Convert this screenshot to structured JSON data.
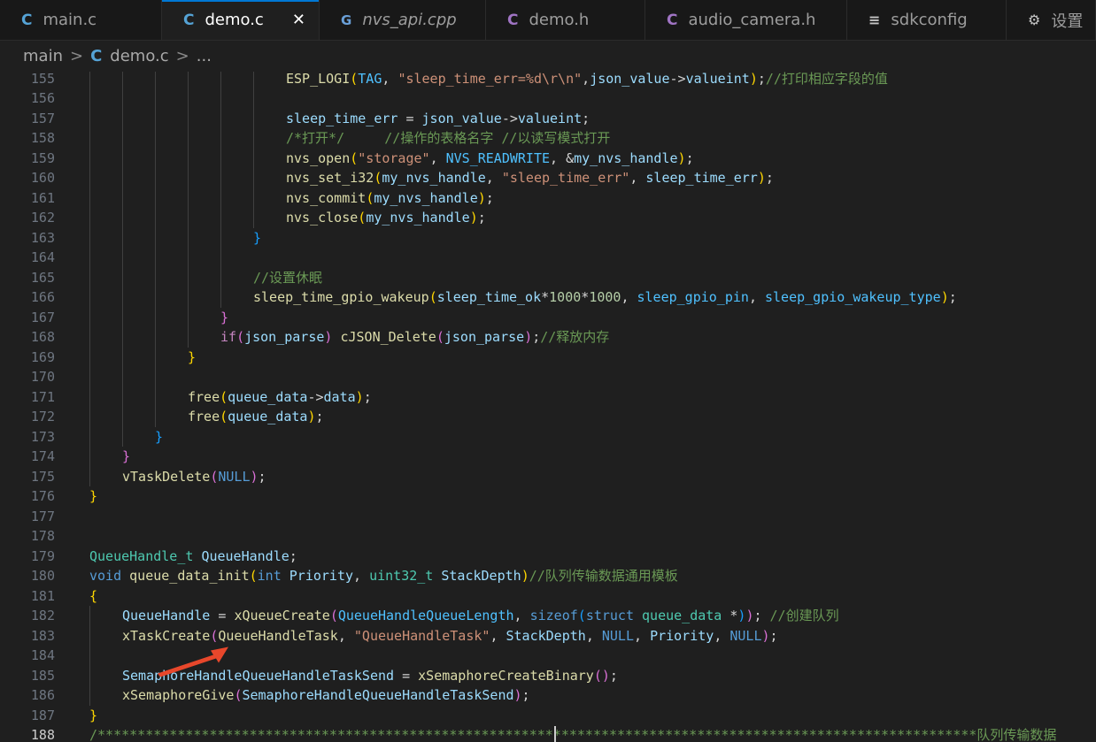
{
  "tabs": [
    {
      "icon": "C",
      "icon_kind": "c",
      "label": "main.c",
      "active": false,
      "italic": false
    },
    {
      "icon": "C",
      "icon_kind": "c",
      "label": "demo.c",
      "active": true,
      "italic": false,
      "close": "✕"
    },
    {
      "icon": "G",
      "icon_kind": "cpp",
      "label": "nvs_api.cpp",
      "active": false,
      "italic": true
    },
    {
      "icon": "C",
      "icon_kind": "h",
      "label": "demo.h",
      "active": false,
      "italic": false
    },
    {
      "icon": "C",
      "icon_kind": "h",
      "label": "audio_camera.h",
      "active": false,
      "italic": false
    },
    {
      "icon": "≡",
      "icon_kind": "menu",
      "label": "sdkconfig",
      "active": false,
      "italic": false
    },
    {
      "icon": "⚙",
      "icon_kind": "menu",
      "label": "设置",
      "active": false,
      "italic": false
    }
  ],
  "breadcrumb": {
    "folder": "main",
    "sep": ">",
    "icon": "C",
    "file": "demo.c",
    "ellipsis": "..."
  },
  "current_line": 188,
  "lines": [
    {
      "n": "155",
      "indent": 6,
      "t": [
        [
          "fn",
          "ESP_LOGI"
        ],
        [
          "b1",
          "("
        ],
        [
          "macro",
          "TAG"
        ],
        [
          "plain",
          ", "
        ],
        [
          "str",
          "\"sleep_time_err=%d\\r\\n\""
        ],
        [
          "plain",
          ","
        ],
        [
          "var",
          "json_value"
        ],
        [
          "plain",
          "->"
        ],
        [
          "var",
          "valueint"
        ],
        [
          "b1",
          ")"
        ],
        [
          "plain",
          ";"
        ],
        [
          "cmt",
          "//打印相应字段的值"
        ]
      ]
    },
    {
      "n": "156",
      "indent": 6,
      "t": []
    },
    {
      "n": "157",
      "indent": 6,
      "t": [
        [
          "var",
          "sleep_time_err"
        ],
        [
          "plain",
          " = "
        ],
        [
          "var",
          "json_value"
        ],
        [
          "plain",
          "->"
        ],
        [
          "var",
          "valueint"
        ],
        [
          "plain",
          ";"
        ]
      ]
    },
    {
      "n": "158",
      "indent": 6,
      "t": [
        [
          "cmt",
          "/*打开*/     //操作的表格名字 //以读写模式打开"
        ]
      ]
    },
    {
      "n": "159",
      "indent": 6,
      "t": [
        [
          "fn",
          "nvs_open"
        ],
        [
          "b1",
          "("
        ],
        [
          "str",
          "\"storage\""
        ],
        [
          "plain",
          ", "
        ],
        [
          "macro",
          "NVS_READWRITE"
        ],
        [
          "plain",
          ", &"
        ],
        [
          "var",
          "my_nvs_handle"
        ],
        [
          "b1",
          ")"
        ],
        [
          "plain",
          ";"
        ]
      ]
    },
    {
      "n": "160",
      "indent": 6,
      "t": [
        [
          "fn",
          "nvs_set_i32"
        ],
        [
          "b1",
          "("
        ],
        [
          "var",
          "my_nvs_handle"
        ],
        [
          "plain",
          ", "
        ],
        [
          "str",
          "\"sleep_time_err\""
        ],
        [
          "plain",
          ", "
        ],
        [
          "var",
          "sleep_time_err"
        ],
        [
          "b1",
          ")"
        ],
        [
          "plain",
          ";"
        ]
      ]
    },
    {
      "n": "161",
      "indent": 6,
      "t": [
        [
          "fn",
          "nvs_commit"
        ],
        [
          "b1",
          "("
        ],
        [
          "var",
          "my_nvs_handle"
        ],
        [
          "b1",
          ")"
        ],
        [
          "plain",
          ";"
        ]
      ]
    },
    {
      "n": "162",
      "indent": 6,
      "t": [
        [
          "fn",
          "nvs_close"
        ],
        [
          "b1",
          "("
        ],
        [
          "var",
          "my_nvs_handle"
        ],
        [
          "b1",
          ")"
        ],
        [
          "plain",
          ";"
        ]
      ]
    },
    {
      "n": "163",
      "indent": 5,
      "t": [
        [
          "b3",
          "}"
        ]
      ]
    },
    {
      "n": "164",
      "indent": 5,
      "t": []
    },
    {
      "n": "165",
      "indent": 5,
      "t": [
        [
          "cmt",
          "//设置休眠"
        ]
      ]
    },
    {
      "n": "166",
      "indent": 5,
      "t": [
        [
          "fn",
          "sleep_time_gpio_wakeup"
        ],
        [
          "b1",
          "("
        ],
        [
          "var",
          "sleep_time_ok"
        ],
        [
          "plain",
          "*"
        ],
        [
          "num",
          "1000"
        ],
        [
          "plain",
          "*"
        ],
        [
          "num",
          "1000"
        ],
        [
          "plain",
          ", "
        ],
        [
          "macro",
          "sleep_gpio_pin"
        ],
        [
          "plain",
          ", "
        ],
        [
          "macro",
          "sleep_gpio_wakeup_type"
        ],
        [
          "b1",
          ")"
        ],
        [
          "plain",
          ";"
        ]
      ]
    },
    {
      "n": "167",
      "indent": 4,
      "t": [
        [
          "b2",
          "}"
        ]
      ]
    },
    {
      "n": "168",
      "indent": 4,
      "t": [
        [
          "ctrl",
          "if"
        ],
        [
          "b2",
          "("
        ],
        [
          "var",
          "json_parse"
        ],
        [
          "b2",
          ")"
        ],
        [
          "plain",
          " "
        ],
        [
          "fn",
          "cJSON_Delete"
        ],
        [
          "b2",
          "("
        ],
        [
          "var",
          "json_parse"
        ],
        [
          "b2",
          ")"
        ],
        [
          "plain",
          ";"
        ],
        [
          "cmt",
          "//释放内存"
        ]
      ]
    },
    {
      "n": "169",
      "indent": 3,
      "t": [
        [
          "b1",
          "}"
        ]
      ]
    },
    {
      "n": "170",
      "indent": 3,
      "t": []
    },
    {
      "n": "171",
      "indent": 3,
      "t": [
        [
          "fn",
          "free"
        ],
        [
          "b1",
          "("
        ],
        [
          "var",
          "queue_data"
        ],
        [
          "plain",
          "->"
        ],
        [
          "var",
          "data"
        ],
        [
          "b1",
          ")"
        ],
        [
          "plain",
          ";"
        ]
      ]
    },
    {
      "n": "172",
      "indent": 3,
      "t": [
        [
          "fn",
          "free"
        ],
        [
          "b1",
          "("
        ],
        [
          "var",
          "queue_data"
        ],
        [
          "b1",
          ")"
        ],
        [
          "plain",
          ";"
        ]
      ]
    },
    {
      "n": "173",
      "indent": 2,
      "t": [
        [
          "b3",
          "}"
        ]
      ]
    },
    {
      "n": "174",
      "indent": 1,
      "t": [
        [
          "b2",
          "}"
        ]
      ]
    },
    {
      "n": "175",
      "indent": 1,
      "t": [
        [
          "fn",
          "vTaskDelete"
        ],
        [
          "b2",
          "("
        ],
        [
          "kw",
          "NULL"
        ],
        [
          "b2",
          ")"
        ],
        [
          "plain",
          ";"
        ]
      ]
    },
    {
      "n": "176",
      "indent": 0,
      "t": [
        [
          "b1",
          "}"
        ]
      ]
    },
    {
      "n": "177",
      "indent": 0,
      "t": []
    },
    {
      "n": "178",
      "indent": 0,
      "t": []
    },
    {
      "n": "179",
      "indent": 0,
      "t": [
        [
          "type",
          "QueueHandle_t"
        ],
        [
          "plain",
          " "
        ],
        [
          "var",
          "QueueHandle"
        ],
        [
          "plain",
          ";"
        ]
      ]
    },
    {
      "n": "180",
      "indent": 0,
      "t": [
        [
          "kw",
          "void"
        ],
        [
          "plain",
          " "
        ],
        [
          "fn",
          "queue_data_init"
        ],
        [
          "b1",
          "("
        ],
        [
          "kw",
          "int"
        ],
        [
          "plain",
          " "
        ],
        [
          "var",
          "Priority"
        ],
        [
          "plain",
          ", "
        ],
        [
          "type",
          "uint32_t"
        ],
        [
          "plain",
          " "
        ],
        [
          "var",
          "StackDepth"
        ],
        [
          "b1",
          ")"
        ],
        [
          "cmt",
          "//队列传输数据通用模板"
        ]
      ]
    },
    {
      "n": "181",
      "indent": 0,
      "t": [
        [
          "b1",
          "{"
        ]
      ]
    },
    {
      "n": "182",
      "indent": 1,
      "t": [
        [
          "var",
          "QueueHandle"
        ],
        [
          "plain",
          " = "
        ],
        [
          "fn",
          "xQueueCreate"
        ],
        [
          "b2",
          "("
        ],
        [
          "macro",
          "QueueHandleQueueLength"
        ],
        [
          "plain",
          ", "
        ],
        [
          "kw",
          "sizeof"
        ],
        [
          "b3",
          "("
        ],
        [
          "kw",
          "struct"
        ],
        [
          "plain",
          " "
        ],
        [
          "type",
          "queue_data"
        ],
        [
          "plain",
          " *"
        ],
        [
          "b3",
          ")"
        ],
        [
          "b2",
          ")"
        ],
        [
          "plain",
          "; "
        ],
        [
          "cmt",
          "//创建队列"
        ]
      ]
    },
    {
      "n": "183",
      "indent": 1,
      "t": [
        [
          "fn",
          "xTaskCreate"
        ],
        [
          "b2",
          "("
        ],
        [
          "fn",
          "QueueHandleTask"
        ],
        [
          "plain",
          ", "
        ],
        [
          "str",
          "\"QueueHandleTask\""
        ],
        [
          "plain",
          ", "
        ],
        [
          "var",
          "StackDepth"
        ],
        [
          "plain",
          ", "
        ],
        [
          "kw",
          "NULL"
        ],
        [
          "plain",
          ", "
        ],
        [
          "var",
          "Priority"
        ],
        [
          "plain",
          ", "
        ],
        [
          "kw",
          "NULL"
        ],
        [
          "b2",
          ")"
        ],
        [
          "plain",
          ";"
        ]
      ]
    },
    {
      "n": "184",
      "indent": 1,
      "t": []
    },
    {
      "n": "185",
      "indent": 1,
      "t": [
        [
          "var",
          "SemaphoreHandleQueueHandleTaskSend"
        ],
        [
          "plain",
          " = "
        ],
        [
          "fn",
          "xSemaphoreCreateBinary"
        ],
        [
          "b2",
          "("
        ],
        [
          "b2",
          ")"
        ],
        [
          "plain",
          ";"
        ]
      ]
    },
    {
      "n": "186",
      "indent": 1,
      "t": [
        [
          "fn",
          "xSemaphoreGive"
        ],
        [
          "b2",
          "("
        ],
        [
          "var",
          "SemaphoreHandleQueueHandleTaskSend"
        ],
        [
          "b2",
          ")"
        ],
        [
          "plain",
          ";"
        ]
      ]
    },
    {
      "n": "187",
      "indent": 0,
      "t": [
        [
          "b1",
          "}"
        ]
      ]
    },
    {
      "n": "188",
      "indent": 0,
      "t": [
        [
          "cmt",
          "/**************************************************************************************************************队列传输数据"
        ]
      ]
    }
  ],
  "annotation": {
    "arrow_color": "#e8472b"
  }
}
